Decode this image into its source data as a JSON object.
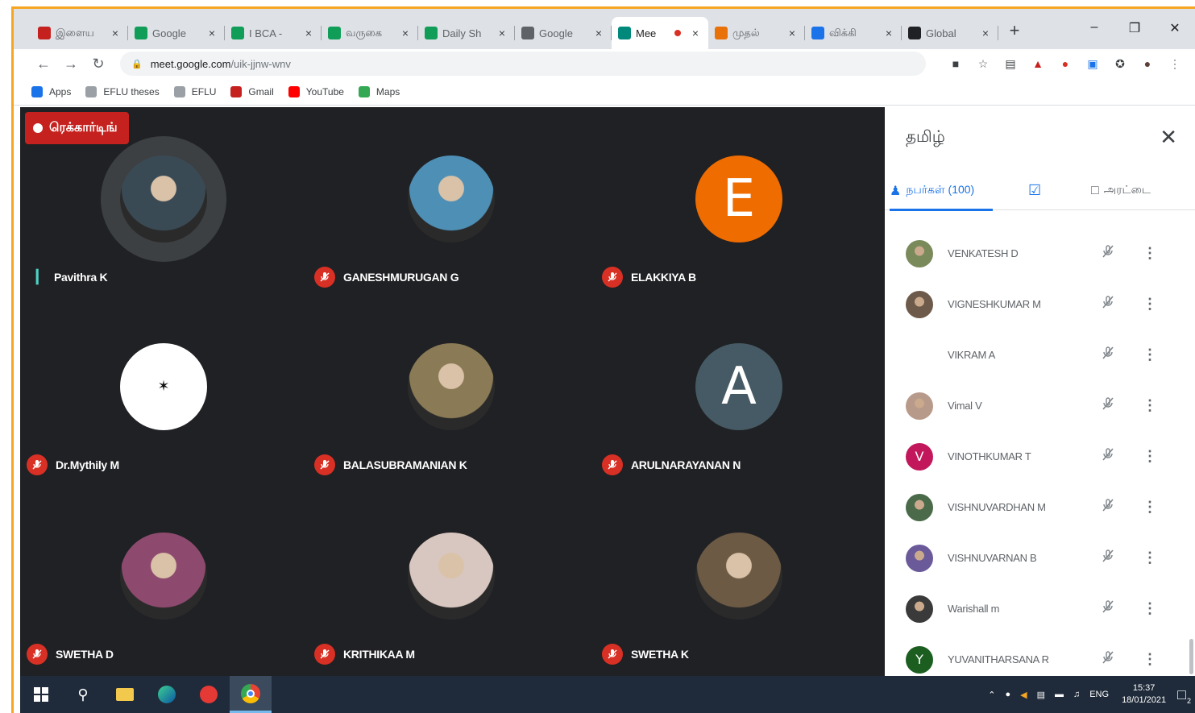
{
  "browser": {
    "tabs": [
      {
        "title": "இளைய",
        "icon": "gmail-icon",
        "color": "#c5221f",
        "active": false
      },
      {
        "title": "Google",
        "icon": "sheets-icon",
        "color": "#0f9d58",
        "active": false
      },
      {
        "title": "I BCA - ",
        "icon": "sheets-icon",
        "color": "#0f9d58",
        "active": false
      },
      {
        "title": "வருகை",
        "icon": "sheets-icon",
        "color": "#0f9d58",
        "active": false
      },
      {
        "title": "Daily Sh",
        "icon": "sheets-icon",
        "color": "#0f9d58",
        "active": false
      },
      {
        "title": "Google",
        "icon": "globe-icon",
        "color": "#5f6368",
        "active": false
      },
      {
        "title": "Mee",
        "icon": "meet-icon",
        "color": "#00897b",
        "active": true
      },
      {
        "title": "முதல்",
        "icon": "bookmark-icon",
        "color": "#e8710a",
        "active": false
      },
      {
        "title": "விக்கி",
        "icon": "globe-icon",
        "color": "#1a73e8",
        "active": false
      },
      {
        "title": "Global",
        "icon": "wikipedia-icon",
        "color": "#202124",
        "active": false
      }
    ],
    "new_tab": "+",
    "url_host": "meet.google.com",
    "url_path": "/uik-jjnw-wnv",
    "bookmarks": [
      {
        "label": "Apps",
        "color": "#1a73e8"
      },
      {
        "label": "EFLU theses",
        "color": "#9aa0a6"
      },
      {
        "label": "EFLU",
        "color": "#9aa0a6"
      },
      {
        "label": "Gmail",
        "color": "#c5221f"
      },
      {
        "label": "YouTube",
        "color": "#ff0000"
      },
      {
        "label": "Maps",
        "color": "#34a853"
      }
    ]
  },
  "meeting": {
    "recording_label": "ரெக்கார்டிங்",
    "tiles": [
      {
        "name": "Pavithra K",
        "speaking": true,
        "avatar": "photo",
        "color": "#3a4a55"
      },
      {
        "name": "GANESHMURUGAN G",
        "speaking": false,
        "avatar": "photo",
        "color": "#4e8fb5"
      },
      {
        "name": "ELAKKIYA B",
        "speaking": false,
        "avatar": "letter",
        "letter": "E",
        "color": "#ef6c00"
      },
      {
        "name": "Dr.Mythily M",
        "speaking": false,
        "avatar": "logo",
        "color": "#ffffff"
      },
      {
        "name": "BALASUBRAMANIAN K",
        "speaking": false,
        "avatar": "photo",
        "color": "#8a7a55"
      },
      {
        "name": "ARULNARAYANAN N",
        "speaking": false,
        "avatar": "letter",
        "letter": "A",
        "color": "#455a64"
      },
      {
        "name": "SWETHA D",
        "speaking": false,
        "avatar": "photo",
        "color": "#8e4a6e"
      },
      {
        "name": "KRITHIKAA M",
        "speaking": false,
        "avatar": "photo",
        "color": "#d8c7c0"
      },
      {
        "name": "SWETHA K",
        "speaking": false,
        "avatar": "photo",
        "color": "#6d5a45"
      }
    ]
  },
  "panel": {
    "title": "தமிழ்",
    "tab_people": "நபர்கள் (100)",
    "tab_chat": "அரட்டை",
    "participants": [
      {
        "name": "VENKATESH D",
        "avatar": "photo",
        "color": "#7a8a5a"
      },
      {
        "name": "VIGNESHKUMAR M",
        "avatar": "photo",
        "color": "#6e5a4a"
      },
      {
        "name": "VIKRAM A",
        "avatar": "none",
        "color": "#ffffff"
      },
      {
        "name": "Vimal V",
        "avatar": "photo",
        "color": "#b89a8a"
      },
      {
        "name": "VINOTHKUMAR T",
        "avatar": "letter",
        "letter": "V",
        "color": "#c2185b"
      },
      {
        "name": "VISHNUVARDHAN M",
        "avatar": "photo",
        "color": "#4a6a4a"
      },
      {
        "name": "VISHNUVARNAN B",
        "avatar": "photo",
        "color": "#6a5a9a"
      },
      {
        "name": "Warishall m",
        "avatar": "photo",
        "color": "#3a3a3a"
      },
      {
        "name": "YUVANITHARSANA R",
        "avatar": "letter",
        "letter": "Y",
        "color": "#1b5e20"
      }
    ]
  },
  "taskbar": {
    "language": "ENG",
    "time": "15:37",
    "date": "18/01/2021",
    "notification_count": "2"
  }
}
